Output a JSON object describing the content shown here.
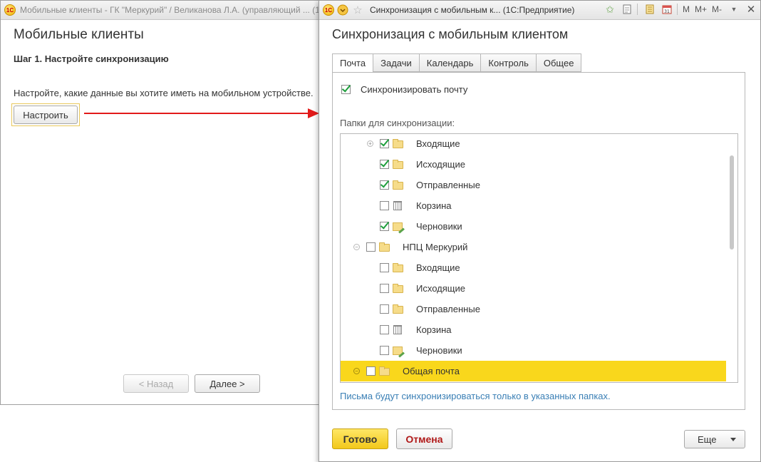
{
  "bg_window": {
    "title": "Мобильные клиенты - ГК \"Меркурий\" / Великанова Л.А. (управляющий ... (1С:Пр",
    "heading": "Мобильные клиенты",
    "step": "Шаг 1. Настройте синхронизацию",
    "description": "Настройте, какие данные вы хотите иметь на мобильном устройстве.",
    "configure_button": "Настроить",
    "back_button": "< Назад",
    "next_button": "Далее >"
  },
  "dialog": {
    "window_title": "Синхронизация с мобильным к...  (1С:Предприятие)",
    "toolbar": {
      "m": "M",
      "m_plus": "M+",
      "m_minus": "M-"
    },
    "heading": "Синхронизация с мобильным клиентом",
    "tabs": [
      "Почта",
      "Задачи",
      "Календарь",
      "Контроль",
      "Общее"
    ],
    "sync_mail_label": "Синхронизировать почту",
    "sync_mail_checked": true,
    "folders_caption": "Папки для синхронизации:",
    "tree": [
      {
        "label": "Входящие",
        "checked": true,
        "icon": "folder",
        "level": 1,
        "expander": "plus"
      },
      {
        "label": "Исходящие",
        "checked": true,
        "icon": "folder",
        "level": 1
      },
      {
        "label": "Отправленные",
        "checked": true,
        "icon": "folder",
        "level": 1
      },
      {
        "label": "Корзина",
        "checked": false,
        "icon": "trash",
        "level": 1
      },
      {
        "label": "Черновики",
        "checked": true,
        "icon": "draft",
        "level": 1
      },
      {
        "label": "НПЦ Меркурий",
        "checked": false,
        "icon": "folder",
        "level": 0,
        "expander": "minus"
      },
      {
        "label": "Входящие",
        "checked": false,
        "icon": "folder",
        "level": 1
      },
      {
        "label": "Исходящие",
        "checked": false,
        "icon": "folder",
        "level": 1
      },
      {
        "label": "Отправленные",
        "checked": false,
        "icon": "folder",
        "level": 1
      },
      {
        "label": "Корзина",
        "checked": false,
        "icon": "trash",
        "level": 1
      },
      {
        "label": "Черновики",
        "checked": false,
        "icon": "draft",
        "level": 1
      },
      {
        "label": "Общая почта",
        "checked": false,
        "icon": "folder",
        "level": 0,
        "expander": "minus",
        "selected": true
      }
    ],
    "hint": "Письма будут синхронизироваться только в указанных папках.",
    "done_button": "Готово",
    "cancel_button": "Отмена",
    "more_button": "Еще"
  }
}
